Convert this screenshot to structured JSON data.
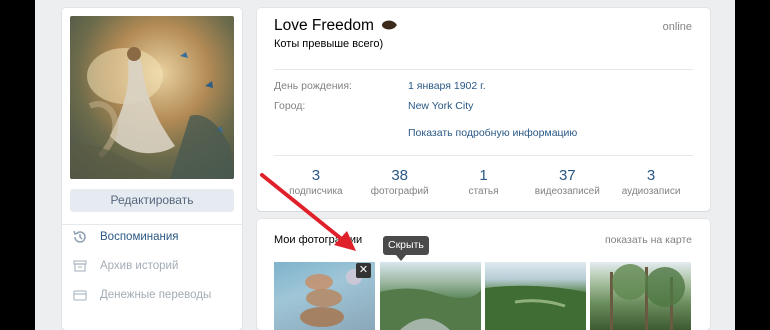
{
  "profile": {
    "name": "Love Freedom",
    "status": "Коты превыше всего)",
    "online": "online",
    "edit_label": "Редактировать",
    "more_info": "Показать подробную информацию",
    "info": [
      {
        "label": "День рождения:",
        "value": "1 января 1902 г."
      },
      {
        "label": "Город:",
        "value": "New York City"
      }
    ],
    "counters": [
      {
        "num": "3",
        "label": "подписчика"
      },
      {
        "num": "38",
        "label": "фотографий"
      },
      {
        "num": "1",
        "label": "статья"
      },
      {
        "num": "37",
        "label": "видеозаписей"
      },
      {
        "num": "3",
        "label": "аудиозаписи"
      }
    ]
  },
  "menu": [
    {
      "label": "Воспоминания",
      "icon": "history-icon"
    },
    {
      "label": "Архив историй",
      "icon": "archive-icon"
    },
    {
      "label": "Денежные переводы",
      "icon": "money-transfer-icon"
    }
  ],
  "photos": {
    "title": "Мои фотографии",
    "map_link": "показать на карте",
    "hide_tooltip": "Скрыть",
    "close_glyph": "✕"
  },
  "colors": {
    "accent": "#2a5885",
    "annotation_arrow": "#e0202a"
  }
}
